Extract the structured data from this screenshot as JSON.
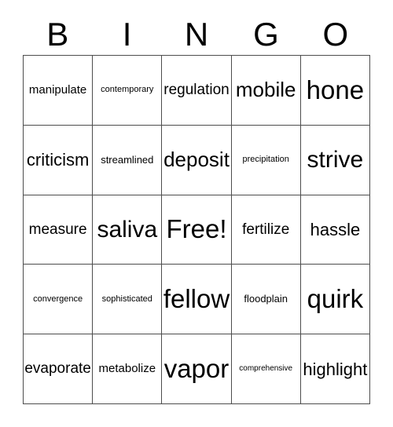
{
  "card": {
    "title": "BINGO",
    "header_letters": [
      "B",
      "I",
      "N",
      "G",
      "O"
    ],
    "free_space_label": "Free!",
    "grid_rows": [
      [
        {
          "word": "manipulate",
          "size": "s-xs"
        },
        {
          "word": "contemporary",
          "size": "s-tiny"
        },
        {
          "word": "regulation",
          "size": "s-sm"
        },
        {
          "word": "mobile",
          "size": "s-lg"
        },
        {
          "word": "hone",
          "size": "s-xxl"
        }
      ],
      [
        {
          "word": "criticism",
          "size": "s-md"
        },
        {
          "word": "streamlined",
          "size": "s-xxs"
        },
        {
          "word": "deposit",
          "size": "s-lg"
        },
        {
          "word": "precipitation",
          "size": "s-tiny"
        },
        {
          "word": "strive",
          "size": "s-xl"
        }
      ],
      [
        {
          "word": "measure",
          "size": "s-sm"
        },
        {
          "word": "saliva",
          "size": "s-xl"
        },
        {
          "word": "Free!",
          "size": "s-xxl"
        },
        {
          "word": "fertilize",
          "size": "s-sm"
        },
        {
          "word": "hassle",
          "size": "s-md"
        }
      ],
      [
        {
          "word": "convergence",
          "size": "s-tiny"
        },
        {
          "word": "sophisticated",
          "size": "s-tiny"
        },
        {
          "word": "fellow",
          "size": "s-xxl"
        },
        {
          "word": "floodplain",
          "size": "s-xxs"
        },
        {
          "word": "quirk",
          "size": "s-xxl"
        }
      ],
      [
        {
          "word": "evaporate",
          "size": "s-sm"
        },
        {
          "word": "metabolize",
          "size": "s-xs"
        },
        {
          "word": "vapor",
          "size": "s-xxl"
        },
        {
          "word": "comprehensive",
          "size": "s-micro"
        },
        {
          "word": "highlight",
          "size": "s-md"
        }
      ]
    ]
  },
  "colors": {
    "background": "#ffffff",
    "text": "#000000",
    "border": "#4d4d4d"
  }
}
